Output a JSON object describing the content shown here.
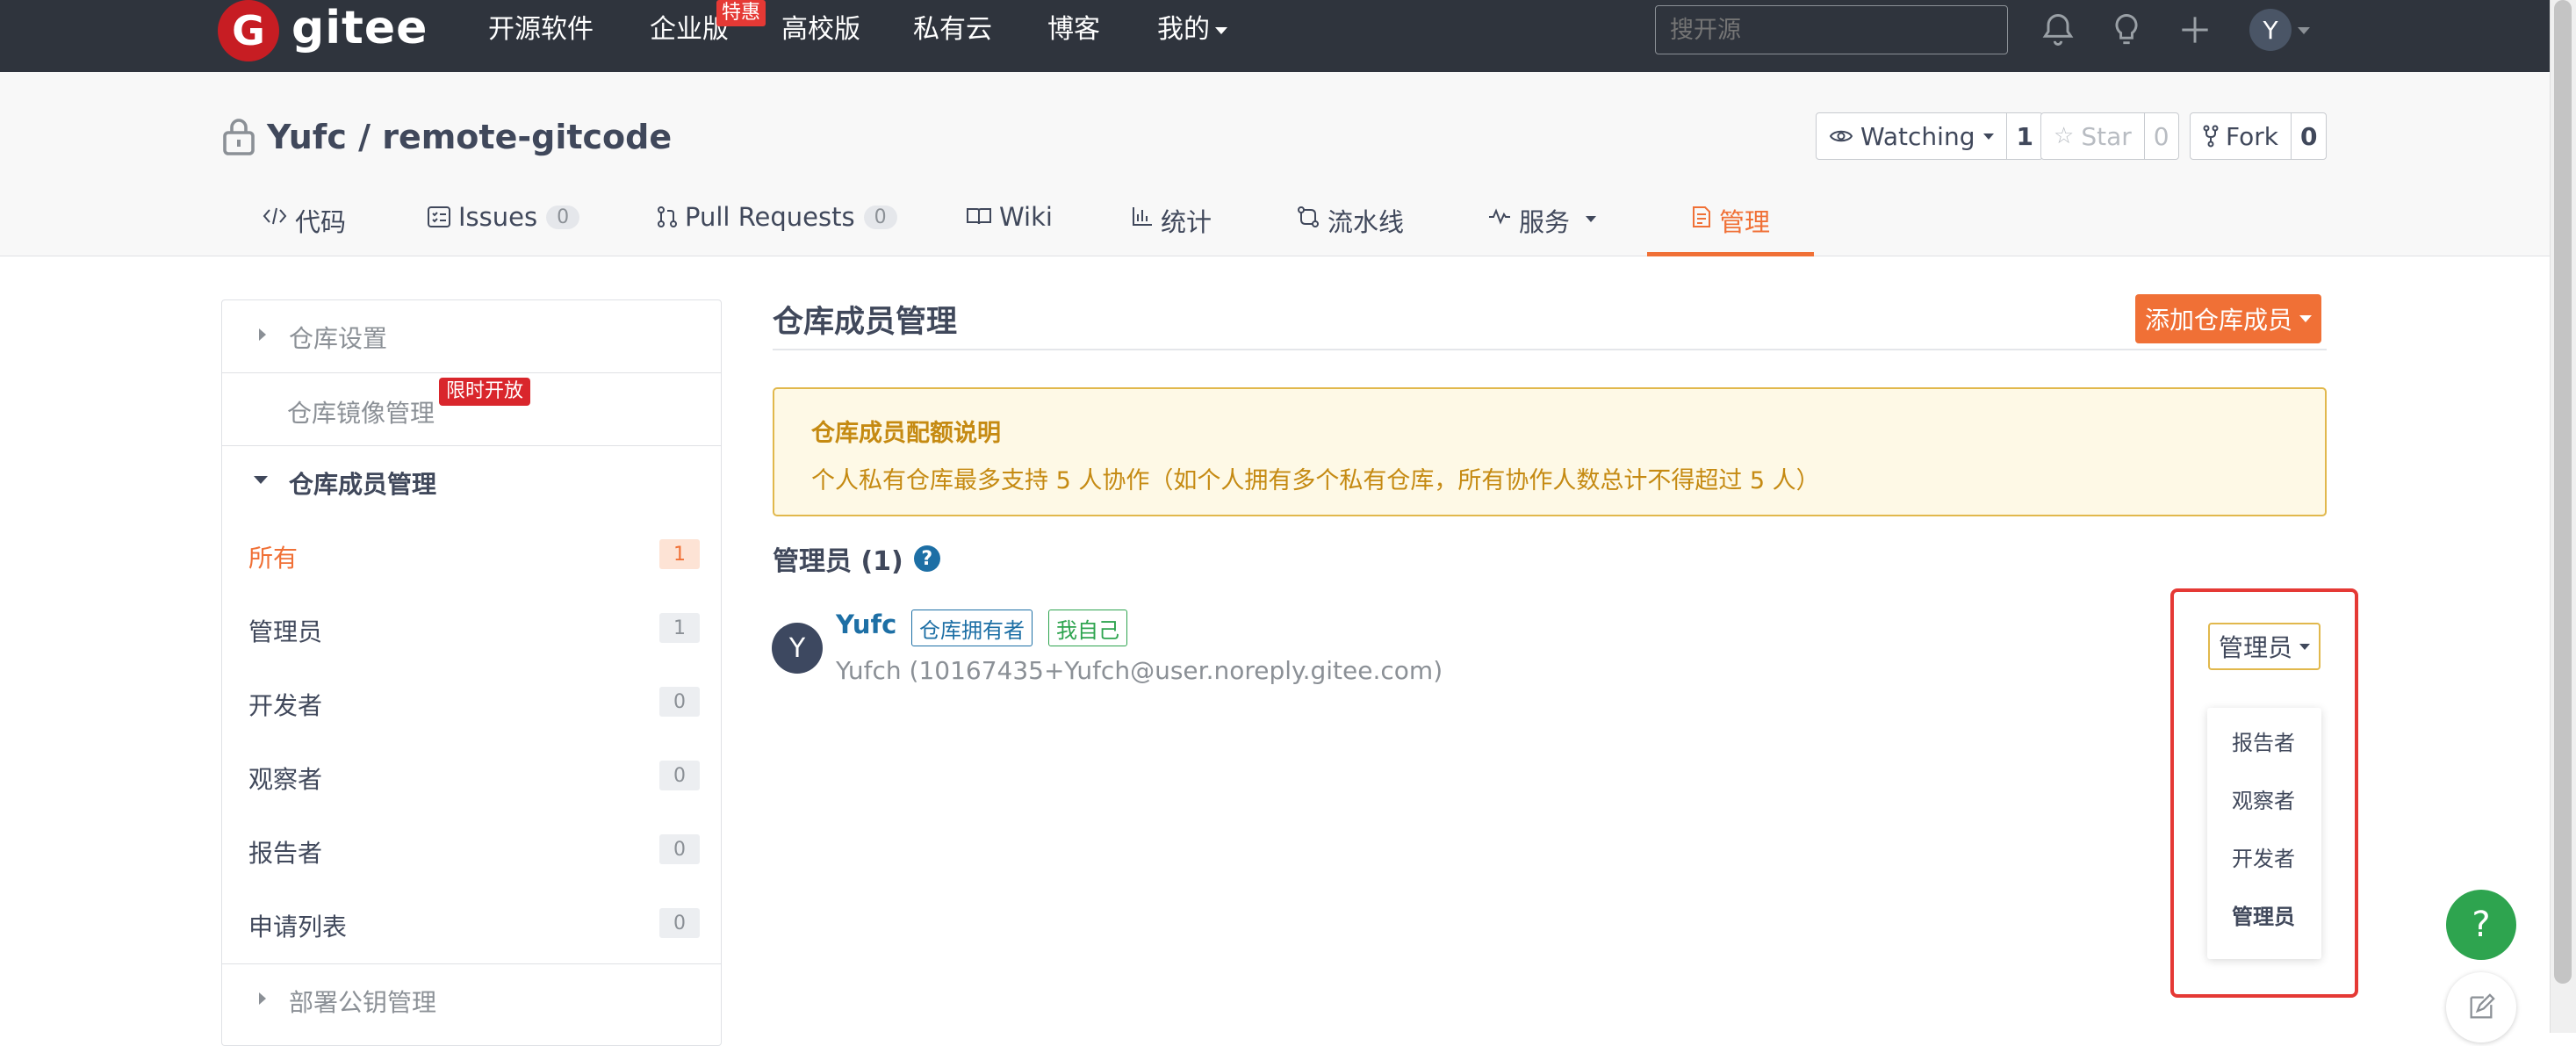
{
  "nav": {
    "logo_letter": "G",
    "logo_text": "gitee",
    "items": [
      "开源软件",
      "企业版",
      "高校版",
      "私有云",
      "博客"
    ],
    "enterprise_badge": "特惠",
    "mine": "我的",
    "search_placeholder": "搜开源",
    "user_initial": "Y"
  },
  "repo": {
    "title": "Yufc / remote-gitcode",
    "watch_label": "Watching",
    "watch_count": "1",
    "star_label": "Star",
    "star_count": "0",
    "fork_label": "Fork",
    "fork_count": "0"
  },
  "tabs": {
    "code": "代码",
    "issues": "Issues",
    "issues_count": "0",
    "prs": "Pull Requests",
    "prs_count": "0",
    "wiki": "Wiki",
    "stats": "统计",
    "pipeline": "流水线",
    "services": "服务",
    "manage": "管理"
  },
  "sidebar": {
    "repo_settings": "仓库设置",
    "mirror_mgmt": "仓库镜像管理",
    "limited_badge": "限时开放",
    "member_mgmt": "仓库成员管理",
    "items": [
      {
        "label": "所有",
        "count": "1"
      },
      {
        "label": "管理员",
        "count": "1"
      },
      {
        "label": "开发者",
        "count": "0"
      },
      {
        "label": "观察者",
        "count": "0"
      },
      {
        "label": "报告者",
        "count": "0"
      },
      {
        "label": "申请列表",
        "count": "0"
      }
    ],
    "deploy_keys": "部署公钥管理"
  },
  "main": {
    "title": "仓库成员管理",
    "add_button": "添加仓库成员",
    "notice_title": "仓库成员配额说明",
    "notice_body": "个人私有仓库最多支持 5 人协作（如个人拥有多个私有仓库，所有协作人数总计不得超过 5 人）",
    "admins_heading": "管理员 (1)",
    "member": {
      "initial": "Y",
      "name": "Yufc",
      "tag_owner": "仓库拥有者",
      "tag_self": "我自己",
      "email": "Yufch (10167435+Yufch@user.noreply.gitee.com)"
    },
    "role_button": "管理员",
    "role_options": [
      "报告者",
      "观察者",
      "开发者",
      "管理员"
    ]
  },
  "colors": {
    "nav_bg": "#2f343d",
    "accent": "#f07036",
    "link": "#1d6fa5",
    "highlight": "#e53935",
    "success": "#2ea44f"
  }
}
